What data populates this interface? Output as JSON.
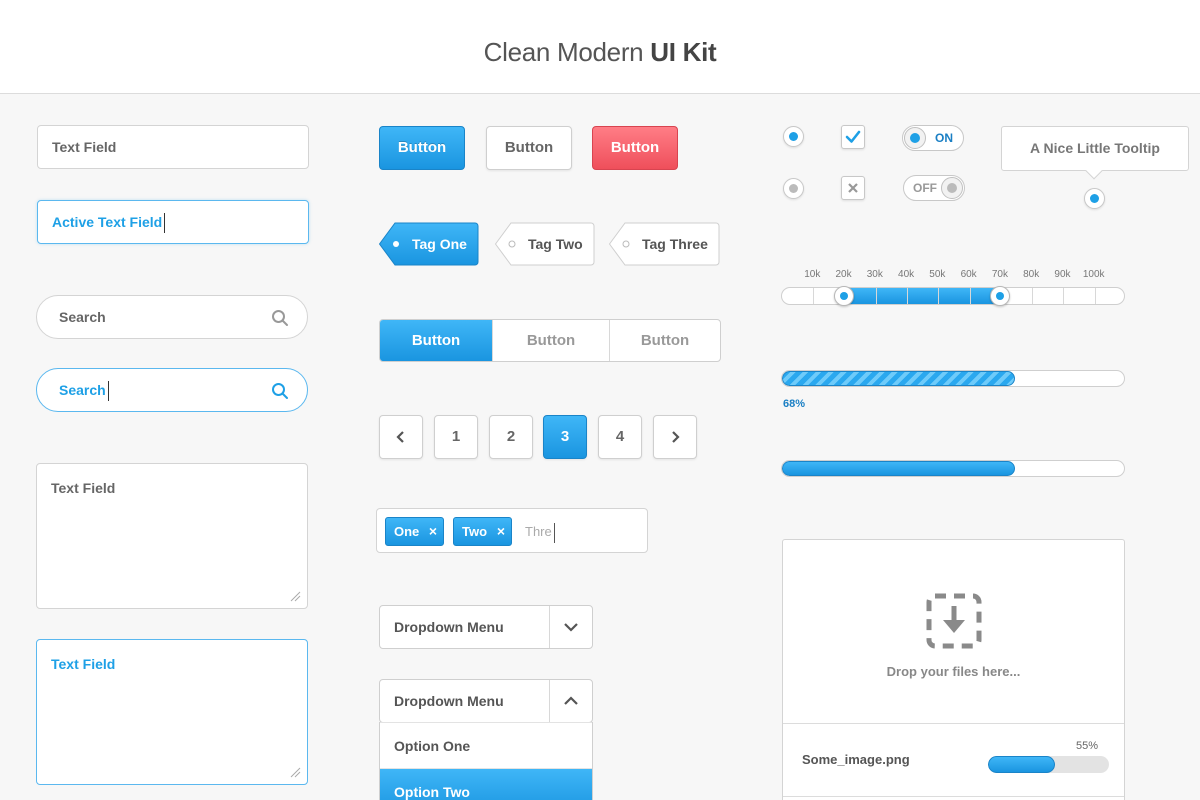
{
  "header": {
    "title_light": "Clean Modern",
    "title_bold": "UI Kit"
  },
  "text_fields": {
    "field1": "Text Field",
    "field_active": "Active Text Field",
    "search1": "Search",
    "search_active": "Search",
    "textarea1": "Text Field",
    "textarea_active": "Text Field"
  },
  "buttons": {
    "blue": "Button",
    "white": "Button",
    "red": "Button"
  },
  "tags": [
    "Tag One",
    "Tag Two",
    "Tag Three"
  ],
  "segmented": {
    "items": [
      "Button",
      "Button",
      "Button"
    ],
    "active_index": 0
  },
  "pagination": {
    "pages": [
      "1",
      "2",
      "3",
      "4"
    ],
    "current": "3"
  },
  "tag_input": {
    "chips": [
      "One",
      "Two"
    ],
    "remove_glyph": "×",
    "typed": "Thre"
  },
  "dropdowns": {
    "closed_label": "Dropdown Menu",
    "open_label": "Dropdown Menu",
    "options": [
      "Option One",
      "Option Two"
    ],
    "selected_option": "Option Two"
  },
  "toggles": {
    "switch_on": "ON",
    "switch_off": "OFF",
    "radio_checked": true,
    "checkbox_checked": true
  },
  "tooltip": {
    "text": "A Nice Little Tooltip"
  },
  "range_slider": {
    "tick_labels": [
      "10k",
      "20k",
      "30k",
      "40k",
      "50k",
      "60k",
      "70k",
      "80k",
      "90k",
      "100k"
    ],
    "low": "20k",
    "high": "70k"
  },
  "progress": {
    "striped_value": 0.68,
    "striped_label": "68%",
    "plain_value": 0.68
  },
  "uploader": {
    "drop_message": "Drop your files here...",
    "file_name": "Some_image.png",
    "file_progress_label": "55%",
    "file_progress": 0.55
  },
  "colors": {
    "accent": "#1ea0e6",
    "danger": "#ef4f5b",
    "border": "#d4d4d4",
    "background": "#f7f7f7"
  }
}
